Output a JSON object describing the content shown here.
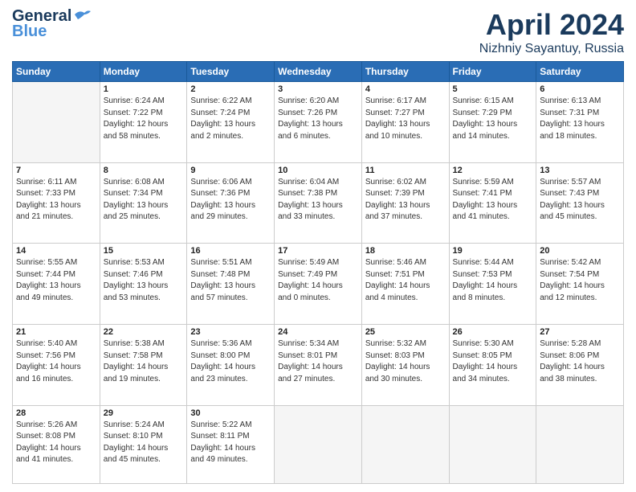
{
  "header": {
    "logo_line1": "General",
    "logo_line2": "Blue",
    "month": "April 2024",
    "location": "Nizhniy Sayantuy, Russia"
  },
  "weekdays": [
    "Sunday",
    "Monday",
    "Tuesday",
    "Wednesday",
    "Thursday",
    "Friday",
    "Saturday"
  ],
  "weeks": [
    [
      {
        "day": "",
        "info": ""
      },
      {
        "day": "1",
        "info": "Sunrise: 6:24 AM\nSunset: 7:22 PM\nDaylight: 12 hours\nand 58 minutes."
      },
      {
        "day": "2",
        "info": "Sunrise: 6:22 AM\nSunset: 7:24 PM\nDaylight: 13 hours\nand 2 minutes."
      },
      {
        "day": "3",
        "info": "Sunrise: 6:20 AM\nSunset: 7:26 PM\nDaylight: 13 hours\nand 6 minutes."
      },
      {
        "day": "4",
        "info": "Sunrise: 6:17 AM\nSunset: 7:27 PM\nDaylight: 13 hours\nand 10 minutes."
      },
      {
        "day": "5",
        "info": "Sunrise: 6:15 AM\nSunset: 7:29 PM\nDaylight: 13 hours\nand 14 minutes."
      },
      {
        "day": "6",
        "info": "Sunrise: 6:13 AM\nSunset: 7:31 PM\nDaylight: 13 hours\nand 18 minutes."
      }
    ],
    [
      {
        "day": "7",
        "info": "Sunrise: 6:11 AM\nSunset: 7:33 PM\nDaylight: 13 hours\nand 21 minutes."
      },
      {
        "day": "8",
        "info": "Sunrise: 6:08 AM\nSunset: 7:34 PM\nDaylight: 13 hours\nand 25 minutes."
      },
      {
        "day": "9",
        "info": "Sunrise: 6:06 AM\nSunset: 7:36 PM\nDaylight: 13 hours\nand 29 minutes."
      },
      {
        "day": "10",
        "info": "Sunrise: 6:04 AM\nSunset: 7:38 PM\nDaylight: 13 hours\nand 33 minutes."
      },
      {
        "day": "11",
        "info": "Sunrise: 6:02 AM\nSunset: 7:39 PM\nDaylight: 13 hours\nand 37 minutes."
      },
      {
        "day": "12",
        "info": "Sunrise: 5:59 AM\nSunset: 7:41 PM\nDaylight: 13 hours\nand 41 minutes."
      },
      {
        "day": "13",
        "info": "Sunrise: 5:57 AM\nSunset: 7:43 PM\nDaylight: 13 hours\nand 45 minutes."
      }
    ],
    [
      {
        "day": "14",
        "info": "Sunrise: 5:55 AM\nSunset: 7:44 PM\nDaylight: 13 hours\nand 49 minutes."
      },
      {
        "day": "15",
        "info": "Sunrise: 5:53 AM\nSunset: 7:46 PM\nDaylight: 13 hours\nand 53 minutes."
      },
      {
        "day": "16",
        "info": "Sunrise: 5:51 AM\nSunset: 7:48 PM\nDaylight: 13 hours\nand 57 minutes."
      },
      {
        "day": "17",
        "info": "Sunrise: 5:49 AM\nSunset: 7:49 PM\nDaylight: 14 hours\nand 0 minutes."
      },
      {
        "day": "18",
        "info": "Sunrise: 5:46 AM\nSunset: 7:51 PM\nDaylight: 14 hours\nand 4 minutes."
      },
      {
        "day": "19",
        "info": "Sunrise: 5:44 AM\nSunset: 7:53 PM\nDaylight: 14 hours\nand 8 minutes."
      },
      {
        "day": "20",
        "info": "Sunrise: 5:42 AM\nSunset: 7:54 PM\nDaylight: 14 hours\nand 12 minutes."
      }
    ],
    [
      {
        "day": "21",
        "info": "Sunrise: 5:40 AM\nSunset: 7:56 PM\nDaylight: 14 hours\nand 16 minutes."
      },
      {
        "day": "22",
        "info": "Sunrise: 5:38 AM\nSunset: 7:58 PM\nDaylight: 14 hours\nand 19 minutes."
      },
      {
        "day": "23",
        "info": "Sunrise: 5:36 AM\nSunset: 8:00 PM\nDaylight: 14 hours\nand 23 minutes."
      },
      {
        "day": "24",
        "info": "Sunrise: 5:34 AM\nSunset: 8:01 PM\nDaylight: 14 hours\nand 27 minutes."
      },
      {
        "day": "25",
        "info": "Sunrise: 5:32 AM\nSunset: 8:03 PM\nDaylight: 14 hours\nand 30 minutes."
      },
      {
        "day": "26",
        "info": "Sunrise: 5:30 AM\nSunset: 8:05 PM\nDaylight: 14 hours\nand 34 minutes."
      },
      {
        "day": "27",
        "info": "Sunrise: 5:28 AM\nSunset: 8:06 PM\nDaylight: 14 hours\nand 38 minutes."
      }
    ],
    [
      {
        "day": "28",
        "info": "Sunrise: 5:26 AM\nSunset: 8:08 PM\nDaylight: 14 hours\nand 41 minutes."
      },
      {
        "day": "29",
        "info": "Sunrise: 5:24 AM\nSunset: 8:10 PM\nDaylight: 14 hours\nand 45 minutes."
      },
      {
        "day": "30",
        "info": "Sunrise: 5:22 AM\nSunset: 8:11 PM\nDaylight: 14 hours\nand 49 minutes."
      },
      {
        "day": "",
        "info": ""
      },
      {
        "day": "",
        "info": ""
      },
      {
        "day": "",
        "info": ""
      },
      {
        "day": "",
        "info": ""
      }
    ]
  ]
}
